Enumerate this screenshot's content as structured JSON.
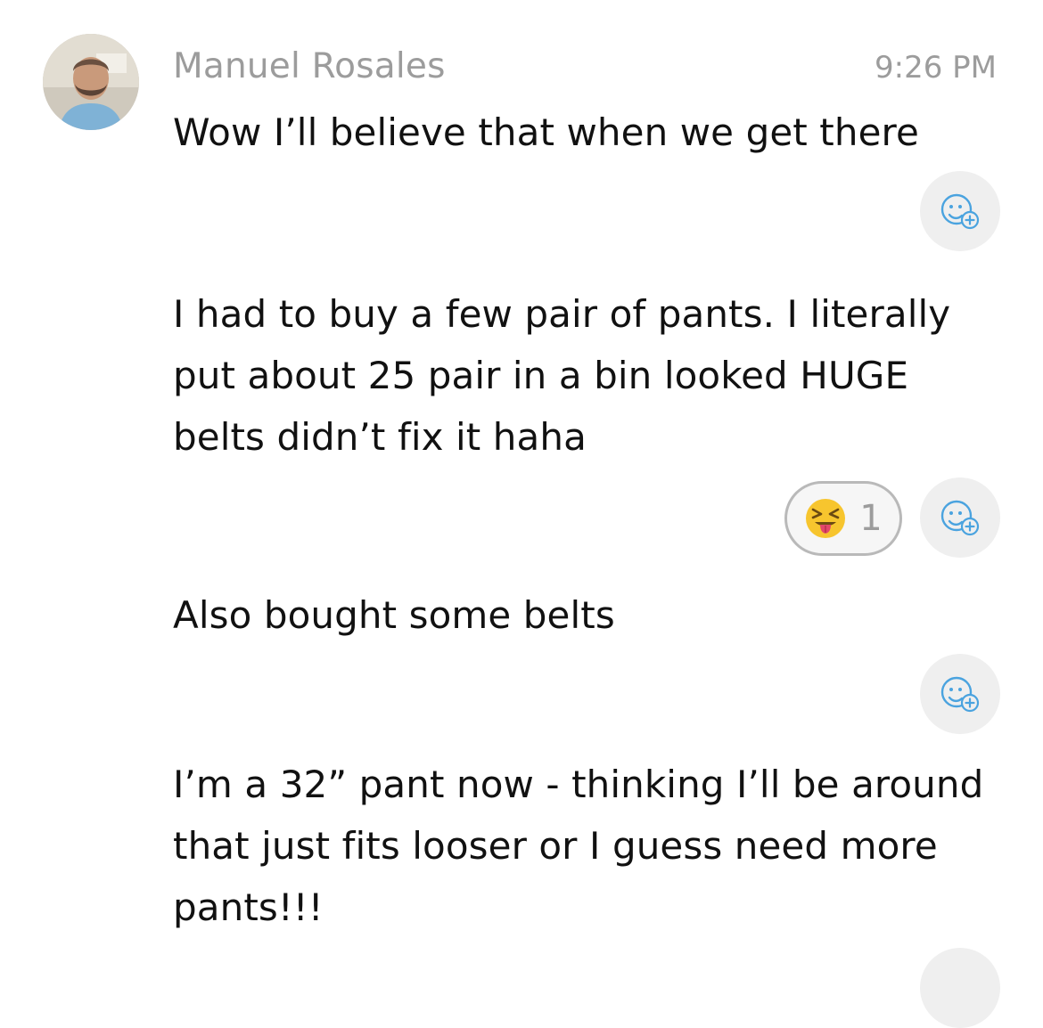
{
  "header": {
    "sender_name": "Manuel Rosales",
    "time": "9:26 PM",
    "avatar": "profile-photo"
  },
  "messages": [
    {
      "text": "Wow I’ll believe that when we get there",
      "reactions": []
    },
    {
      "text": "I had to buy a few pair of pants. I literally put about 25 pair in a bin looked HUGE belts didn’t fix it haha",
      "reactions": [
        {
          "emoji": "squinting-face-with-tongue",
          "count": "1"
        }
      ]
    },
    {
      "text": "Also bought some belts",
      "reactions": []
    },
    {
      "text": "I’m a 32” pant now - thinking I’ll be around that just fits looser or I guess need more pants!!!",
      "reactions": []
    }
  ],
  "icons": {
    "add_reaction": "add-reaction-icon"
  },
  "colors": {
    "accent_icon": "#4aa3df",
    "muted_text": "#9c9c9c",
    "button_bg": "#efefef"
  }
}
